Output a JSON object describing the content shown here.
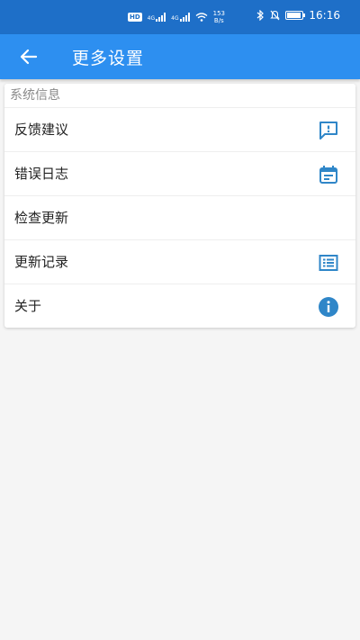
{
  "status_bar": {
    "hd_label": "HD",
    "net_label_1": "4G",
    "net_label_2": "4G",
    "speed_value": "153",
    "speed_unit": "B/s",
    "battery_level": 0.9,
    "time": "16:16",
    "bg_color": "#1e6fc8"
  },
  "app_bar": {
    "title": "更多设置",
    "back_icon": "arrow-left-icon",
    "bg_color": "#2d8ff0"
  },
  "section": {
    "header": "系统信息",
    "items": [
      {
        "label": "反馈建议",
        "icon": "feedback-icon"
      },
      {
        "label": "错误日志",
        "icon": "calendar-icon"
      },
      {
        "label": "检查更新",
        "icon": ""
      },
      {
        "label": "更新记录",
        "icon": "list-icon"
      },
      {
        "label": "关于",
        "icon": "info-icon"
      }
    ]
  },
  "colors": {
    "accent": "#2d8ff0",
    "icon_blue": "#2f86c8",
    "background": "#f5f5f5"
  }
}
